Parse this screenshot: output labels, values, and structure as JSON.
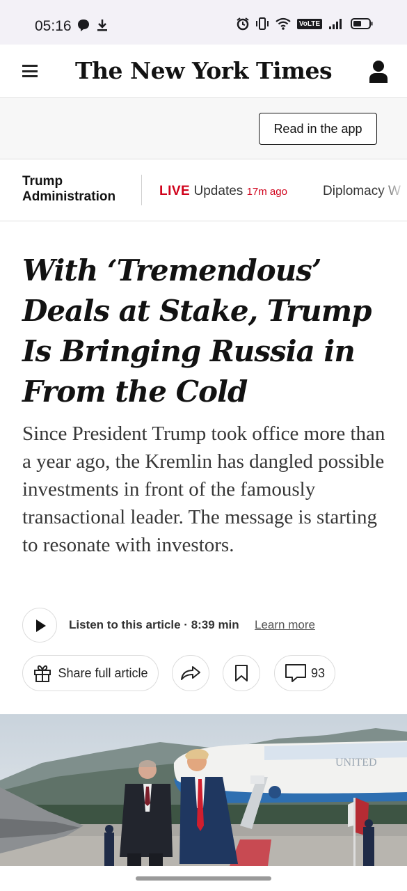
{
  "status_bar": {
    "time": "05:16",
    "left_icons": [
      "chat-bubble-icon",
      "download-icon"
    ],
    "right_icons": [
      "alarm-icon",
      "vibrate-icon",
      "wifi-icon",
      "volte-icon",
      "signal-icon",
      "battery-icon"
    ],
    "volte_label": "VoLTE"
  },
  "masthead": {
    "logo": "The New York Times",
    "menu_icon": "hamburger-menu-icon",
    "account_icon": "account-icon"
  },
  "app_bar": {
    "read_in_app": "Read in the app"
  },
  "section_nav": {
    "section": "Trump Administration",
    "live_badge": "LIVE",
    "live_text": "Updates",
    "live_time": "17m ago",
    "next_link": "Diplomacy W"
  },
  "article": {
    "headline": "With ‘Tremendous’ Deals at Stake, Trump Is Bringing Russia in From the Cold",
    "summary": "Since President Trump took office more than a year ago, the Kremlin has dangled possible investments in front of the famously transactional leader. The message is starting to resonate with investors.",
    "listen": {
      "label": "Listen to this article · 8:39 min",
      "learn_more": "Learn more"
    },
    "actions": {
      "share_label": "Share full article",
      "comment_count": "93"
    },
    "photo_plane_text": "UNITED"
  },
  "colors": {
    "live_red": "#d0021b",
    "text": "#121212",
    "status_bar_bg": "#f3f1f7"
  }
}
